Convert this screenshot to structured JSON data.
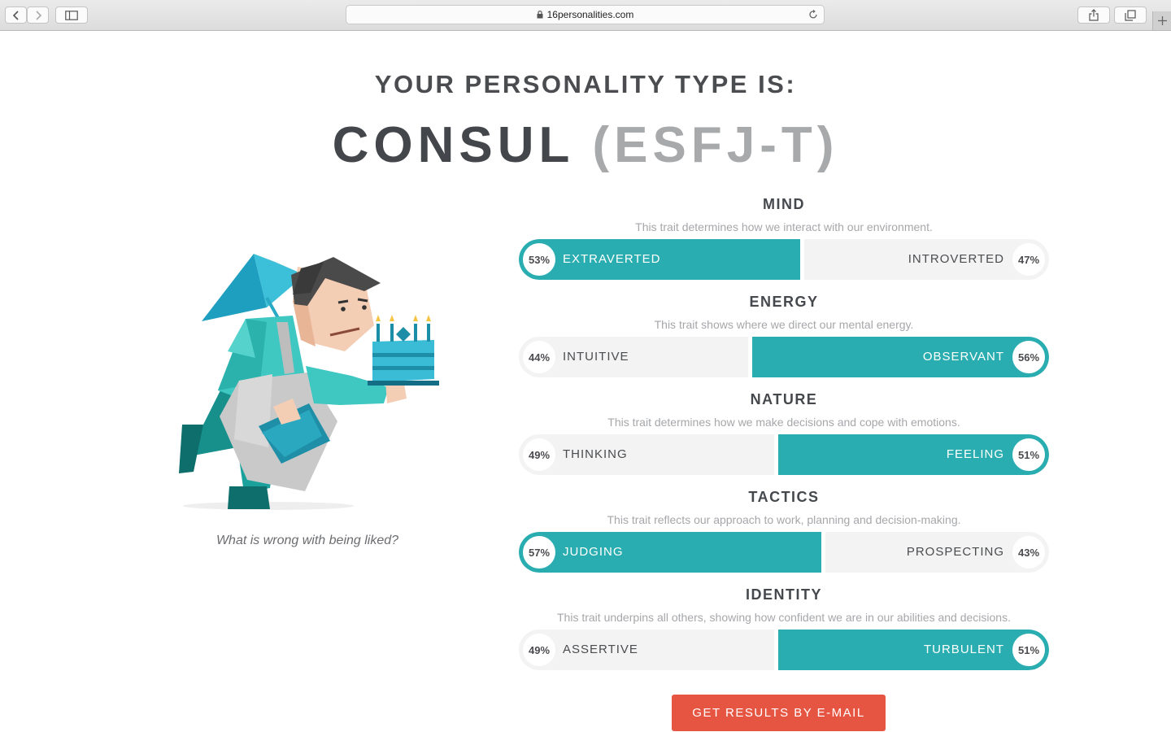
{
  "browser": {
    "url": "16personalities.com"
  },
  "page": {
    "heading": "YOUR PERSONALITY TYPE IS:",
    "type_name": "CONSUL",
    "type_code": "(ESFJ-T)",
    "quote": "What is wrong with being liked?",
    "email_button": "GET RESULTS BY E-MAIL"
  },
  "colors": {
    "accent": "#2aadb0",
    "button": "#e65442",
    "inactive_bar": "#f3f3f3"
  },
  "traits": [
    {
      "title": "MIND",
      "description": "This trait determines how we interact with our environment.",
      "left_label": "EXTRAVERTED",
      "left_pct": "53%",
      "right_label": "INTROVERTED",
      "right_pct": "47%",
      "dominant": "left",
      "share": 0.53
    },
    {
      "title": "ENERGY",
      "description": "This trait shows where we direct our mental energy.",
      "left_label": "INTUITIVE",
      "left_pct": "44%",
      "right_label": "OBSERVANT",
      "right_pct": "56%",
      "dominant": "right",
      "share": 0.56
    },
    {
      "title": "NATURE",
      "description": "This trait determines how we make decisions and cope with emotions.",
      "left_label": "THINKING",
      "left_pct": "49%",
      "right_label": "FEELING",
      "right_pct": "51%",
      "dominant": "right",
      "share": 0.51
    },
    {
      "title": "TACTICS",
      "description": "This trait reflects our approach to work, planning and decision-making.",
      "left_label": "JUDGING",
      "left_pct": "57%",
      "right_label": "PROSPECTING",
      "right_pct": "43%",
      "dominant": "left",
      "share": 0.57
    },
    {
      "title": "IDENTITY",
      "description": "This trait underpins all others, showing how confident we are in our abilities and decisions.",
      "left_label": "ASSERTIVE",
      "left_pct": "49%",
      "right_label": "TURBULENT",
      "right_pct": "51%",
      "dominant": "right",
      "share": 0.51
    }
  ]
}
